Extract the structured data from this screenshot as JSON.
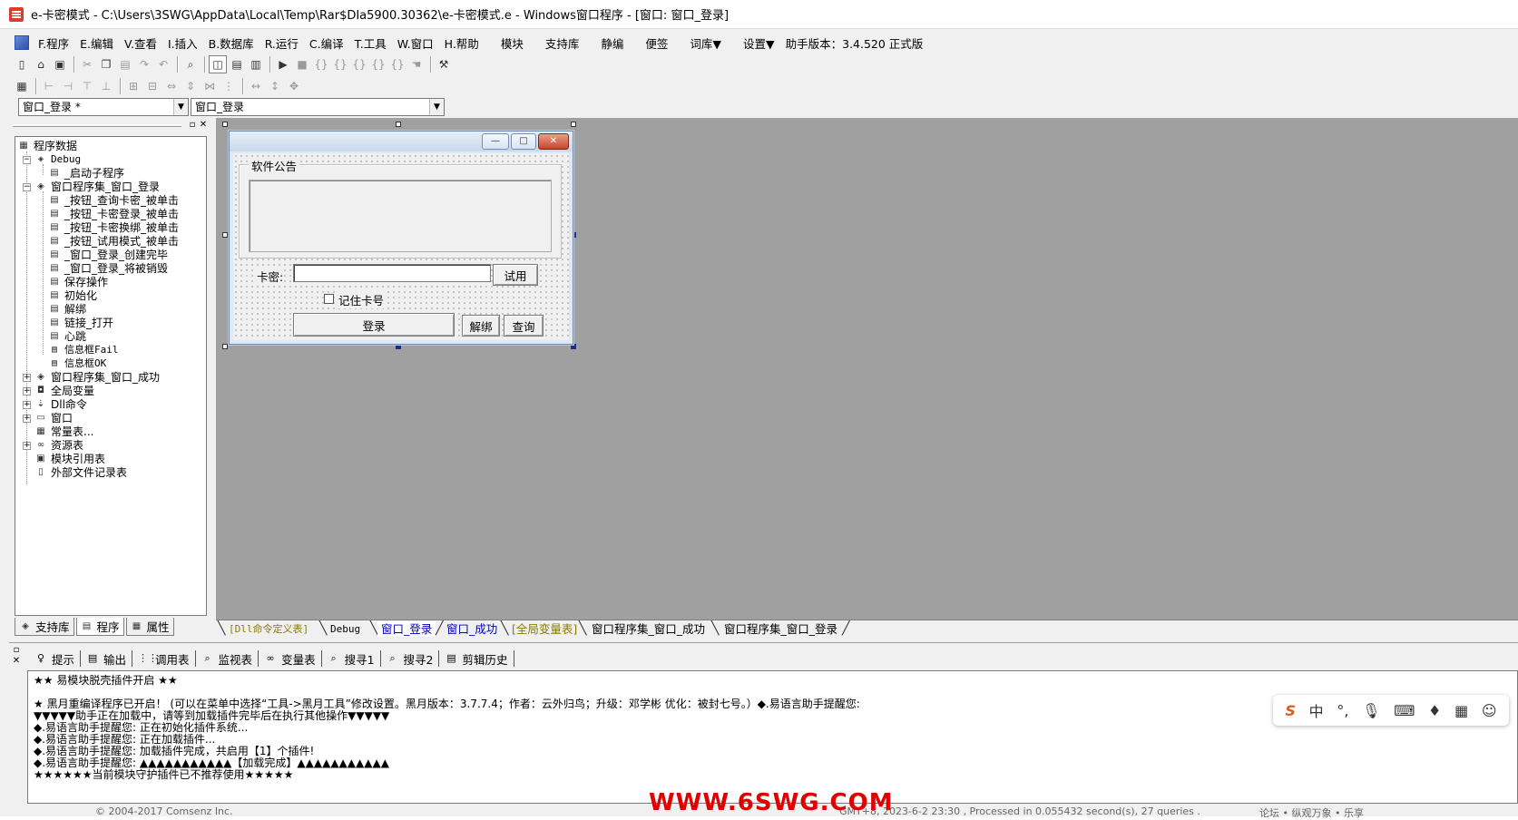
{
  "window": {
    "title": "e-卡密模式 - C:\\Users\\3SWG\\AppData\\Local\\Temp\\Rar$DIa5900.30362\\e-卡密模式.e - Windows窗口程序 - [窗口: 窗口_登录]"
  },
  "menu": {
    "items": [
      "F.程序",
      "E.编辑",
      "V.查看",
      "I.插入",
      "B.数据库",
      "R.运行",
      "C.编译",
      "T.工具",
      "W.窗口",
      "H.帮助"
    ],
    "extras": [
      "模块",
      "支持库",
      "静编",
      "便签",
      "词库▼",
      "设置▼"
    ],
    "version": "助手版本：3.4.520 正式版"
  },
  "combos": {
    "left": "窗口_登录 *",
    "right": "窗口_登录"
  },
  "tree": {
    "root": "程序数据",
    "debug": "Debug",
    "start_sub": "_启动子程序",
    "login_set": "窗口程序集_窗口_登录",
    "login_subs": [
      "_按钮_查询卡密_被单击",
      "_按钮_卡密登录_被单击",
      "_按钮_卡密换绑_被单击",
      "_按钮_试用模式_被单击",
      "_窗口_登录_创建完毕",
      "_窗口_登录_将被销毁",
      "保存操作",
      "初始化",
      "解绑",
      "链接_打开",
      "心跳",
      "信息框Fail",
      "信息框OK"
    ],
    "success_set": "窗口程序集_窗口_成功",
    "globals": "全局变量",
    "dll": "Dll命令",
    "window": "窗口",
    "constants": "常量表...",
    "resources": "资源表",
    "modules": "模块引用表",
    "external": "外部文件记录表"
  },
  "left_tabs": [
    "支持库",
    "程序",
    "属性"
  ],
  "form": {
    "group_label": "软件公告",
    "card_label": "卡密:",
    "card_value": "",
    "trial_button": "试用",
    "remember_label": "记住卡号",
    "login_button": "登录",
    "unbind_button": "解绑",
    "query_button": "查询"
  },
  "doc_tabs": [
    "[Dll命令定义表]",
    "Debug",
    "窗口_登录",
    "窗口_成功",
    "[全局变量表]",
    "窗口程序集_窗口_成功",
    "窗口程序集_窗口_登录"
  ],
  "output_tabs": [
    "提示",
    "输出",
    "调用表",
    "监视表",
    "变量表",
    "搜寻1",
    "搜寻2",
    "剪辑历史"
  ],
  "output_lines": [
    "★★ 易模块脱壳插件开启 ★★",
    "",
    "★ 黑月重编译程序已开启！ (可以在菜单中选择“工具->黑月工具”修改设置。黑月版本：3.7.7.4；作者：云外归鸟；升级：邓学彬 优化：被封七号。）◆.易语言助手提醒您:",
    "▼▼▼▼▼助手正在加载中，请等到加载插件完毕后在执行其他操作▼▼▼▼▼",
    "◆.易语言助手提醒您: 正在初始化插件系统...",
    "◆.易语言助手提醒您: 正在加载插件...",
    "◆.易语言助手提醒您: 加载插件完成，共启用【1】个插件!",
    "◆.易语言助手提醒您: ▲▲▲▲▲▲▲▲▲▲▲【加载完成】▲▲▲▲▲▲▲▲▲▲▲",
    "★★★★★★当前模块守护插件已不推荐使用★★★★★"
  ],
  "ime": {
    "mode": "中",
    "punct": "°,"
  },
  "watermark": "WWW.6SWG.COM",
  "footer": {
    "left": "© 2004-2017 Comsenz Inc.",
    "mid": "GMT+8, 2023-6-2 23:30 , Processed in 0.055432 second(s), 27 queries .",
    "right": "论坛 • 纵观万象 • 乐享"
  },
  "icons": [
    "new-file-icon",
    "open-folder-icon",
    "save-icon",
    "cut-icon",
    "copy-icon",
    "paste-icon",
    "run-icon",
    "stop-icon"
  ]
}
